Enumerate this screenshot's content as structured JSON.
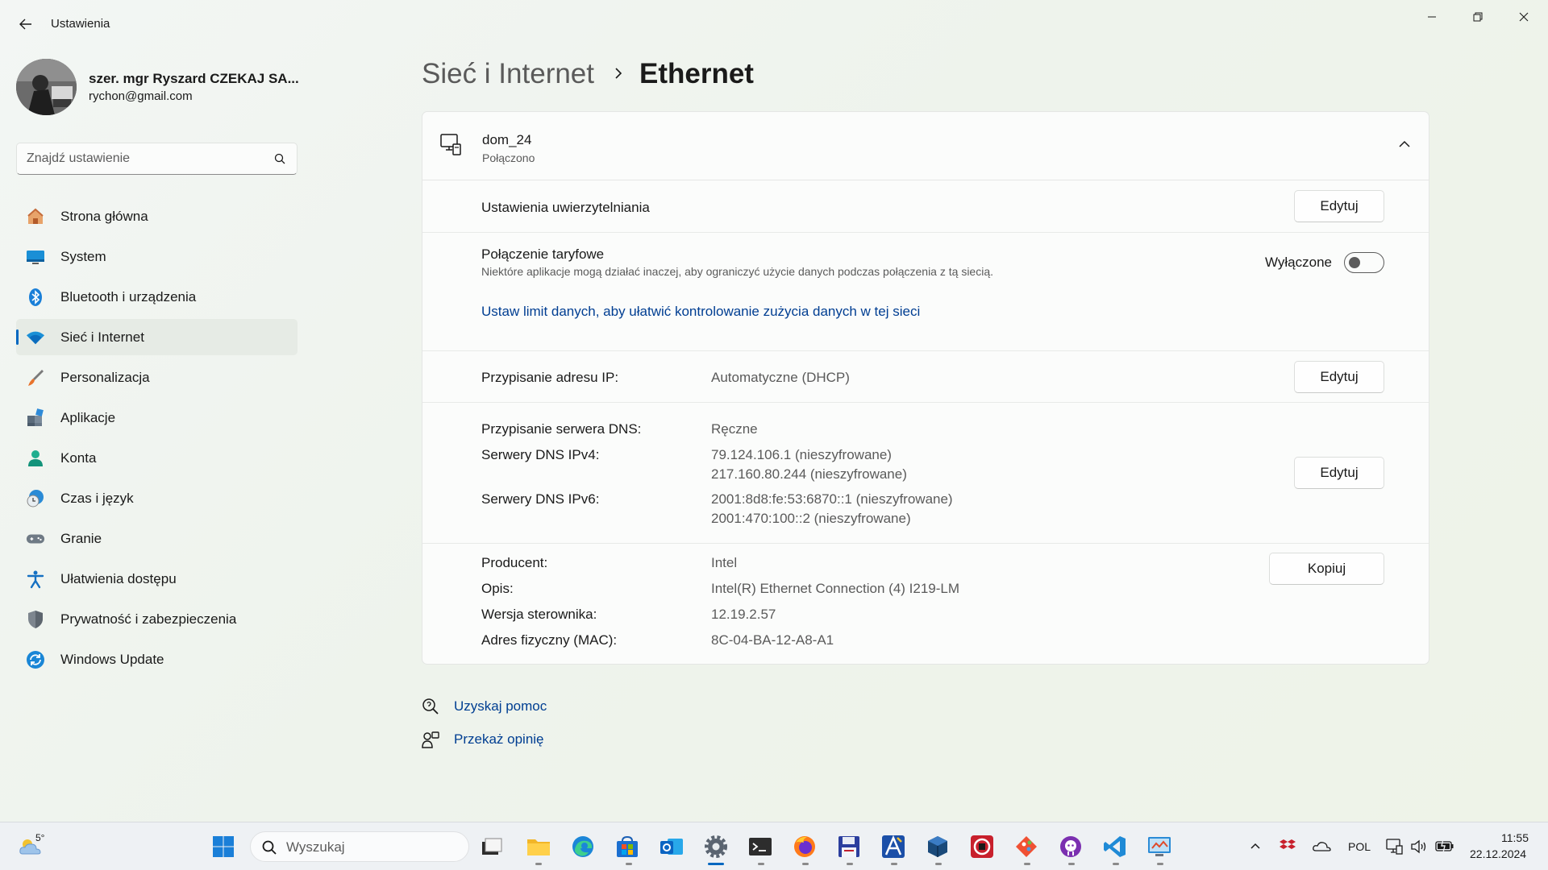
{
  "window": {
    "title": "Ustawienia",
    "controls": [
      "minimize-icon",
      "restore-icon",
      "close-icon"
    ]
  },
  "profile": {
    "name": "szer. mgr Ryszard CZEKAJ SA...",
    "email": "rychon@gmail.com"
  },
  "search": {
    "placeholder": "Znajdź ustawienie"
  },
  "nav": {
    "items": [
      {
        "label": "Strona główna",
        "icon": "home-icon",
        "active": false
      },
      {
        "label": "System",
        "icon": "system-icon",
        "active": false
      },
      {
        "label": "Bluetooth i urządzenia",
        "icon": "bluetooth-icon",
        "active": false
      },
      {
        "label": "Sieć i Internet",
        "icon": "wifi-icon",
        "active": true
      },
      {
        "label": "Personalizacja",
        "icon": "brush-icon",
        "active": false
      },
      {
        "label": "Aplikacje",
        "icon": "apps-icon",
        "active": false
      },
      {
        "label": "Konta",
        "icon": "account-icon",
        "active": false
      },
      {
        "label": "Czas i język",
        "icon": "clock-globe-icon",
        "active": false
      },
      {
        "label": "Granie",
        "icon": "gamepad-icon",
        "active": false
      },
      {
        "label": "Ułatwienia dostępu",
        "icon": "accessibility-icon",
        "active": false
      },
      {
        "label": "Prywatność i zabezpieczenia",
        "icon": "shield-icon",
        "active": false
      },
      {
        "label": "Windows Update",
        "icon": "update-icon",
        "active": false
      }
    ]
  },
  "header": {
    "parent": "Sieć i Internet",
    "current": "Ethernet"
  },
  "network": {
    "name": "dom_24",
    "status": "Połączono"
  },
  "auth": {
    "label": "Ustawienia uwierzytelniania",
    "button": "Edytuj"
  },
  "metered": {
    "label": "Połączenie taryfowe",
    "description": "Niektóre aplikacje mogą działać inaczej, aby ograniczyć użycie danych podczas połączenia z tą siecią.",
    "state_label": "Wyłączone",
    "enabled": false,
    "link": "Ustaw limit danych, aby ułatwić kontrolowanie zużycia danych w tej sieci"
  },
  "ip": {
    "label": "Przypisanie adresu IP:",
    "value": "Automatyczne (DHCP)",
    "button": "Edytuj"
  },
  "dns": {
    "assign_label": "Przypisanie serwera DNS:",
    "assign_value": "Ręczne",
    "ipv4_label": "Serwery DNS IPv4:",
    "ipv4_values": [
      "79.124.106.1 (nieszyfrowane)",
      "217.160.80.244 (nieszyfrowane)"
    ],
    "ipv6_label": "Serwery DNS IPv6:",
    "ipv6_values": [
      "2001:8d8:fe:53:6870::1 (nieszyfrowane)",
      "2001:470:100::2 (nieszyfrowane)"
    ],
    "button": "Edytuj"
  },
  "adapter": {
    "manufacturer_label": "Producent:",
    "manufacturer_value": "Intel",
    "description_label": "Opis:",
    "description_value": "Intel(R) Ethernet Connection (4) I219-LM",
    "driver_label": "Wersja sterownika:",
    "driver_value": "12.19.2.57",
    "mac_label": "Adres fizyczny (MAC):",
    "mac_value": "8C-04-BA-12-A8-A1",
    "button": "Kopiuj"
  },
  "help": {
    "get_help": "Uzyskaj pomoc",
    "feedback": "Przekaż opinię"
  },
  "taskbar": {
    "weather_temp": "5°",
    "search_placeholder": "Wyszukaj",
    "apps": [
      "windows-start-icon",
      "task-view-icon",
      "file-explorer-icon",
      "edge-icon",
      "store-icon",
      "outlook-icon",
      "settings-icon",
      "terminal-icon",
      "firefox-icon",
      "save-disk-icon",
      "drawing-app-icon",
      "virtualbox-icon",
      "gallery-app-icon",
      "git-icon",
      "github-icon",
      "vscode-icon",
      "control-panel-icon"
    ],
    "language": "POL",
    "time": "11:55",
    "date": "22.12.2024"
  },
  "colors": {
    "accent": "#0067c0",
    "link": "#003e92",
    "background": "#eef3ec",
    "card": "#fbfcfb"
  }
}
